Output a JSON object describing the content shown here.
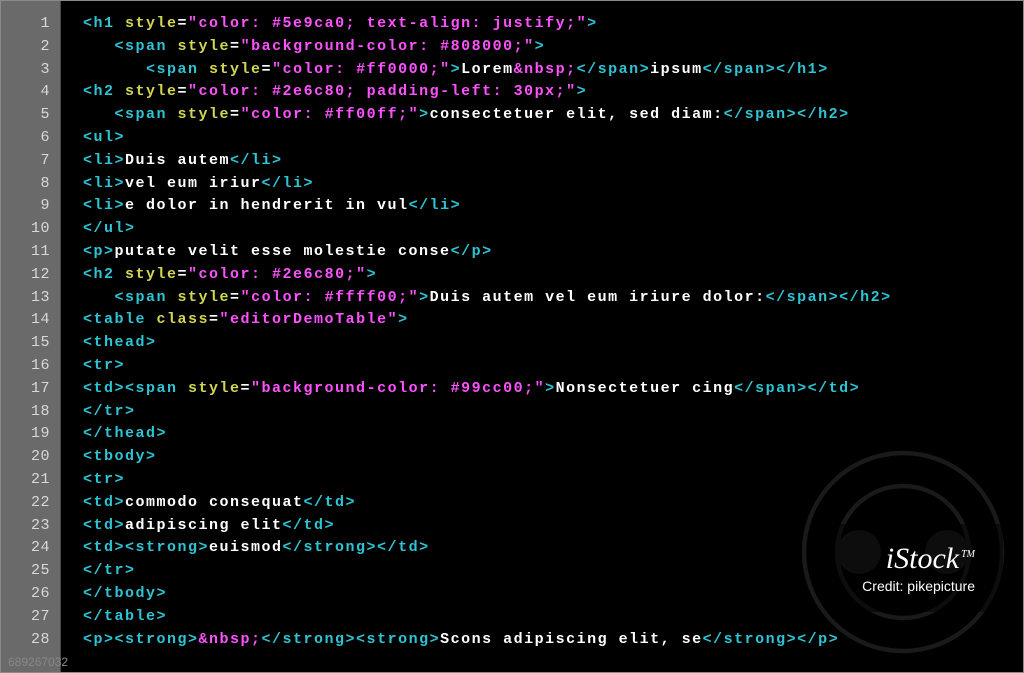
{
  "line_numbers": [
    "1",
    "2",
    "3",
    "4",
    "5",
    "6",
    "7",
    "8",
    "9",
    "10",
    "11",
    "12",
    "13",
    "14",
    "15",
    "16",
    "17",
    "18",
    "19",
    "20",
    "21",
    "22",
    "23",
    "24",
    "25",
    "26",
    "27",
    "28"
  ],
  "code_lines": [
    {
      "indent": 0,
      "tokens": [
        {
          "cls": "tok-tag",
          "t": "<h1 "
        },
        {
          "cls": "tok-attr",
          "t": "style"
        },
        {
          "cls": "tok-eq",
          "t": "="
        },
        {
          "cls": "tok-str",
          "t": "\"color: #5e9ca0; text-align: justify;\""
        },
        {
          "cls": "tok-tag",
          "t": ">"
        }
      ]
    },
    {
      "indent": 1,
      "tokens": [
        {
          "cls": "tok-tag",
          "t": "<span "
        },
        {
          "cls": "tok-attr",
          "t": "style"
        },
        {
          "cls": "tok-eq",
          "t": "="
        },
        {
          "cls": "tok-str",
          "t": "\"background-color: #808000;\""
        },
        {
          "cls": "tok-tag",
          "t": ">"
        }
      ]
    },
    {
      "indent": 2,
      "tokens": [
        {
          "cls": "tok-tag",
          "t": "<span "
        },
        {
          "cls": "tok-attr",
          "t": "style"
        },
        {
          "cls": "tok-eq",
          "t": "="
        },
        {
          "cls": "tok-str",
          "t": "\"color: #ff0000;\""
        },
        {
          "cls": "tok-tag",
          "t": ">"
        },
        {
          "cls": "tok-text",
          "t": "Lorem"
        },
        {
          "cls": "tok-entity",
          "t": "&nbsp;"
        },
        {
          "cls": "tok-tag",
          "t": "</span>"
        },
        {
          "cls": "tok-text",
          "t": "ipsum"
        },
        {
          "cls": "tok-tag",
          "t": "</span></h1>"
        }
      ]
    },
    {
      "indent": 0,
      "tokens": [
        {
          "cls": "tok-tag",
          "t": "<h2 "
        },
        {
          "cls": "tok-attr",
          "t": "style"
        },
        {
          "cls": "tok-eq",
          "t": "="
        },
        {
          "cls": "tok-str",
          "t": "\"color: #2e6c80; padding-left: 30px;\""
        },
        {
          "cls": "tok-tag",
          "t": ">"
        }
      ]
    },
    {
      "indent": 1,
      "tokens": [
        {
          "cls": "tok-tag",
          "t": "<span "
        },
        {
          "cls": "tok-attr",
          "t": "style"
        },
        {
          "cls": "tok-eq",
          "t": "="
        },
        {
          "cls": "tok-str",
          "t": "\"color: #ff00ff;\""
        },
        {
          "cls": "tok-tag",
          "t": ">"
        },
        {
          "cls": "tok-text",
          "t": "consectetuer elit, sed diam:"
        },
        {
          "cls": "tok-tag",
          "t": "</span></h2>"
        }
      ]
    },
    {
      "indent": 0,
      "tokens": [
        {
          "cls": "tok-tag",
          "t": "<ul>"
        }
      ]
    },
    {
      "indent": 0,
      "tokens": [
        {
          "cls": "tok-tag",
          "t": "<li>"
        },
        {
          "cls": "tok-text",
          "t": "Duis autem"
        },
        {
          "cls": "tok-tag",
          "t": "</li>"
        }
      ]
    },
    {
      "indent": 0,
      "tokens": [
        {
          "cls": "tok-tag",
          "t": "<li>"
        },
        {
          "cls": "tok-text",
          "t": "vel eum iriur"
        },
        {
          "cls": "tok-tag",
          "t": "</li>"
        }
      ]
    },
    {
      "indent": 0,
      "tokens": [
        {
          "cls": "tok-tag",
          "t": "<li>"
        },
        {
          "cls": "tok-text",
          "t": "e dolor in hendrerit in vul"
        },
        {
          "cls": "tok-tag",
          "t": "</li>"
        }
      ]
    },
    {
      "indent": 0,
      "tokens": [
        {
          "cls": "tok-tag",
          "t": "</ul>"
        }
      ]
    },
    {
      "indent": 0,
      "tokens": [
        {
          "cls": "tok-tag",
          "t": "<p>"
        },
        {
          "cls": "tok-text",
          "t": "putate velit esse molestie conse"
        },
        {
          "cls": "tok-tag",
          "t": "</p>"
        }
      ]
    },
    {
      "indent": 0,
      "tokens": [
        {
          "cls": "tok-tag",
          "t": "<h2 "
        },
        {
          "cls": "tok-attr",
          "t": "style"
        },
        {
          "cls": "tok-eq",
          "t": "="
        },
        {
          "cls": "tok-str",
          "t": "\"color: #2e6c80;\""
        },
        {
          "cls": "tok-tag",
          "t": ">"
        }
      ]
    },
    {
      "indent": 1,
      "tokens": [
        {
          "cls": "tok-tag",
          "t": "<span "
        },
        {
          "cls": "tok-attr",
          "t": "style"
        },
        {
          "cls": "tok-eq",
          "t": "="
        },
        {
          "cls": "tok-str",
          "t": "\"color: #ffff00;\""
        },
        {
          "cls": "tok-tag",
          "t": ">"
        },
        {
          "cls": "tok-text",
          "t": "Duis autem vel eum iriure dolor:"
        },
        {
          "cls": "tok-tag",
          "t": "</span></h2>"
        }
      ]
    },
    {
      "indent": 0,
      "tokens": [
        {
          "cls": "tok-tag",
          "t": "<table "
        },
        {
          "cls": "tok-attr",
          "t": "class"
        },
        {
          "cls": "tok-eq",
          "t": "="
        },
        {
          "cls": "tok-str",
          "t": "\"editorDemoTable\""
        },
        {
          "cls": "tok-tag",
          "t": ">"
        }
      ]
    },
    {
      "indent": 0,
      "tokens": [
        {
          "cls": "tok-tag",
          "t": "<thead>"
        }
      ]
    },
    {
      "indent": 0,
      "tokens": [
        {
          "cls": "tok-tag",
          "t": "<tr>"
        }
      ]
    },
    {
      "indent": 0,
      "tokens": [
        {
          "cls": "tok-tag",
          "t": "<td><span "
        },
        {
          "cls": "tok-attr",
          "t": "style"
        },
        {
          "cls": "tok-eq",
          "t": "="
        },
        {
          "cls": "tok-str",
          "t": "\"background-color: #99cc00;\""
        },
        {
          "cls": "tok-tag",
          "t": ">"
        },
        {
          "cls": "tok-text",
          "t": "Nonsectetuer cing"
        },
        {
          "cls": "tok-tag",
          "t": "</span></td>"
        }
      ]
    },
    {
      "indent": 0,
      "tokens": [
        {
          "cls": "tok-tag",
          "t": "</tr>"
        }
      ]
    },
    {
      "indent": 0,
      "tokens": [
        {
          "cls": "tok-tag",
          "t": "</thead>"
        }
      ]
    },
    {
      "indent": 0,
      "tokens": [
        {
          "cls": "tok-tag",
          "t": "<tbody>"
        }
      ]
    },
    {
      "indent": 0,
      "tokens": [
        {
          "cls": "tok-tag",
          "t": "<tr>"
        }
      ]
    },
    {
      "indent": 0,
      "tokens": [
        {
          "cls": "tok-tag",
          "t": "<td>"
        },
        {
          "cls": "tok-text",
          "t": "commodo consequat"
        },
        {
          "cls": "tok-tag",
          "t": "</td>"
        }
      ]
    },
    {
      "indent": 0,
      "tokens": [
        {
          "cls": "tok-tag",
          "t": "<td>"
        },
        {
          "cls": "tok-text",
          "t": "adipiscing elit"
        },
        {
          "cls": "tok-tag",
          "t": "</td>"
        }
      ]
    },
    {
      "indent": 0,
      "tokens": [
        {
          "cls": "tok-tag",
          "t": "<td><strong>"
        },
        {
          "cls": "tok-text",
          "t": "euismod"
        },
        {
          "cls": "tok-tag",
          "t": "</strong></td>"
        }
      ]
    },
    {
      "indent": 0,
      "tokens": [
        {
          "cls": "tok-tag",
          "t": "</tr>"
        }
      ]
    },
    {
      "indent": 0,
      "tokens": [
        {
          "cls": "tok-tag",
          "t": "</tbody>"
        }
      ]
    },
    {
      "indent": 0,
      "tokens": [
        {
          "cls": "tok-tag",
          "t": "</table>"
        }
      ]
    },
    {
      "indent": 0,
      "tokens": [
        {
          "cls": "tok-tag",
          "t": "<p><strong>"
        },
        {
          "cls": "tok-entity",
          "t": "&nbsp;"
        },
        {
          "cls": "tok-tag",
          "t": "</strong><strong>"
        },
        {
          "cls": "tok-text",
          "t": "Scons adipiscing elit, se"
        },
        {
          "cls": "tok-tag",
          "t": "</strong></p>"
        }
      ]
    }
  ],
  "watermark": {
    "logo": "iStock",
    "credit": "Credit: pikepicture",
    "id": "689267032"
  }
}
